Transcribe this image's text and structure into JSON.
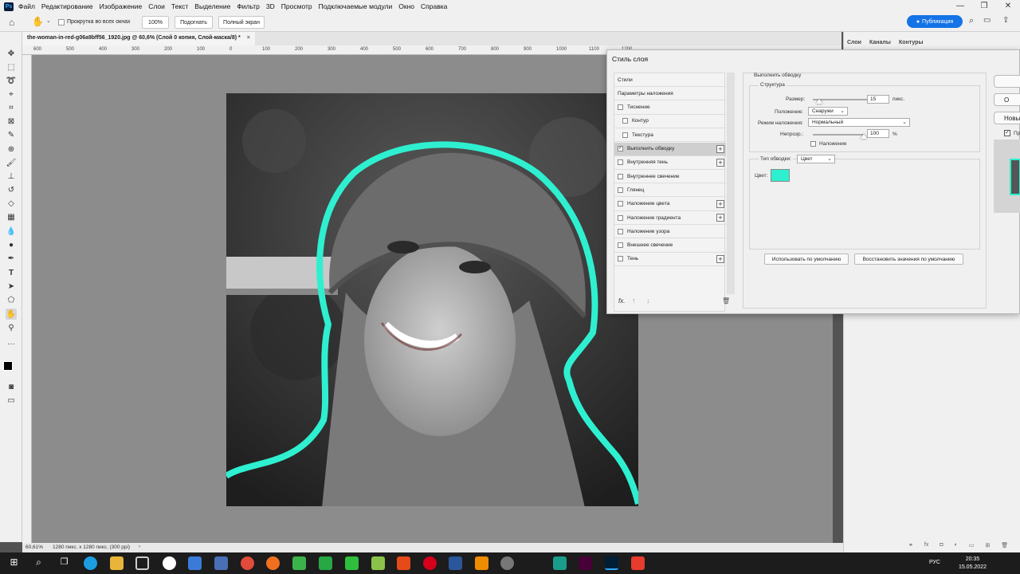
{
  "app": {
    "logo_text": "Ps"
  },
  "menu": [
    "Файл",
    "Редактирование",
    "Изображение",
    "Слои",
    "Текст",
    "Выделение",
    "Фильтр",
    "3D",
    "Просмотр",
    "Подключаемые модули",
    "Окно",
    "Справка"
  ],
  "options": {
    "scroll_all_label": "Прокрутка во всех окнах",
    "zoom_100_label": "100%",
    "fit_label": "Подогнать",
    "fullscreen_label": "Полный экран",
    "publish_label": "Публикация"
  },
  "document": {
    "tab_title": "the-woman-in-red-g06a9bff56_1920.jpg @ 60,6% (Слой 0 копия, Слой-маска/8) *",
    "status_zoom": "60,61%",
    "status_info": "1280 пикс. x 1280 пикс. (300 ppi)",
    "ruler_ticks": [
      "600",
      "500",
      "400",
      "300",
      "200",
      "100",
      "0",
      "100",
      "200",
      "300",
      "400",
      "500",
      "600",
      "700",
      "800",
      "900",
      "1000",
      "1100",
      "1200"
    ]
  },
  "panels": {
    "tabs": [
      "Слои",
      "Каналы",
      "Контуры"
    ]
  },
  "dialog": {
    "title": "Стиль слоя",
    "styles": [
      {
        "label": "Стили",
        "checkbox": false,
        "checked": false,
        "plus": false,
        "indent": false,
        "selected": false
      },
      {
        "label": "Параметры наложения",
        "checkbox": false,
        "checked": false,
        "plus": false,
        "indent": false,
        "selected": false
      },
      {
        "label": "Тиснение",
        "checkbox": true,
        "checked": false,
        "plus": false,
        "indent": false,
        "selected": false
      },
      {
        "label": "Контур",
        "checkbox": true,
        "checked": false,
        "plus": false,
        "indent": true,
        "selected": false
      },
      {
        "label": "Текстура",
        "checkbox": true,
        "checked": false,
        "plus": false,
        "indent": true,
        "selected": false
      },
      {
        "label": "Выполнить обводку",
        "checkbox": true,
        "checked": true,
        "plus": true,
        "indent": false,
        "selected": true
      },
      {
        "label": "Внутренняя тень",
        "checkbox": true,
        "checked": false,
        "plus": true,
        "indent": false,
        "selected": false
      },
      {
        "label": "Внутреннее свечение",
        "checkbox": true,
        "checked": false,
        "plus": false,
        "indent": false,
        "selected": false
      },
      {
        "label": "Глянец",
        "checkbox": true,
        "checked": false,
        "plus": false,
        "indent": false,
        "selected": false
      },
      {
        "label": "Наложение цвета",
        "checkbox": true,
        "checked": false,
        "plus": true,
        "indent": false,
        "selected": false
      },
      {
        "label": "Наложение градиента",
        "checkbox": true,
        "checked": false,
        "plus": true,
        "indent": false,
        "selected": false
      },
      {
        "label": "Наложение узора",
        "checkbox": true,
        "checked": false,
        "plus": false,
        "indent": false,
        "selected": false
      },
      {
        "label": "Внешнее свечение",
        "checkbox": true,
        "checked": false,
        "plus": false,
        "indent": false,
        "selected": false
      },
      {
        "label": "Тень",
        "checkbox": true,
        "checked": false,
        "plus": true,
        "indent": false,
        "selected": false
      }
    ],
    "fx_label": "fx.",
    "stroke": {
      "section_title": "Выполнить обводку",
      "structure_title": "Структура",
      "size_label": "Размер:",
      "size_value": "15",
      "size_unit": "пикс.",
      "position_label": "Положение:",
      "position_value": "Снаружи",
      "blend_label": "Режим наложения:",
      "blend_value": "Нормальный",
      "opacity_label": "Непрозр.:",
      "opacity_value": "100",
      "opacity_unit": "%",
      "overprint_label": "Наложение",
      "fill_type_label": "Тип обводки:",
      "fill_type_value": "Цвет",
      "color_label": "Цвет:",
      "color_hex": "#2ef0d0",
      "default_btn": "Использовать по умолчанию",
      "reset_btn": "Восстановить значения по умолчанию",
      "size_fraction": 0.1,
      "opacity_fraction": 1.0
    },
    "right_buttons": [
      "",
      "О",
      "Новы"
    ],
    "preview_label": "Пр"
  },
  "taskbar": {
    "lang": "РУС",
    "time": "20:35",
    "date": "15.05.2022"
  },
  "colors": {
    "accent": "#1473e6",
    "stroke": "#2ef0d0"
  }
}
